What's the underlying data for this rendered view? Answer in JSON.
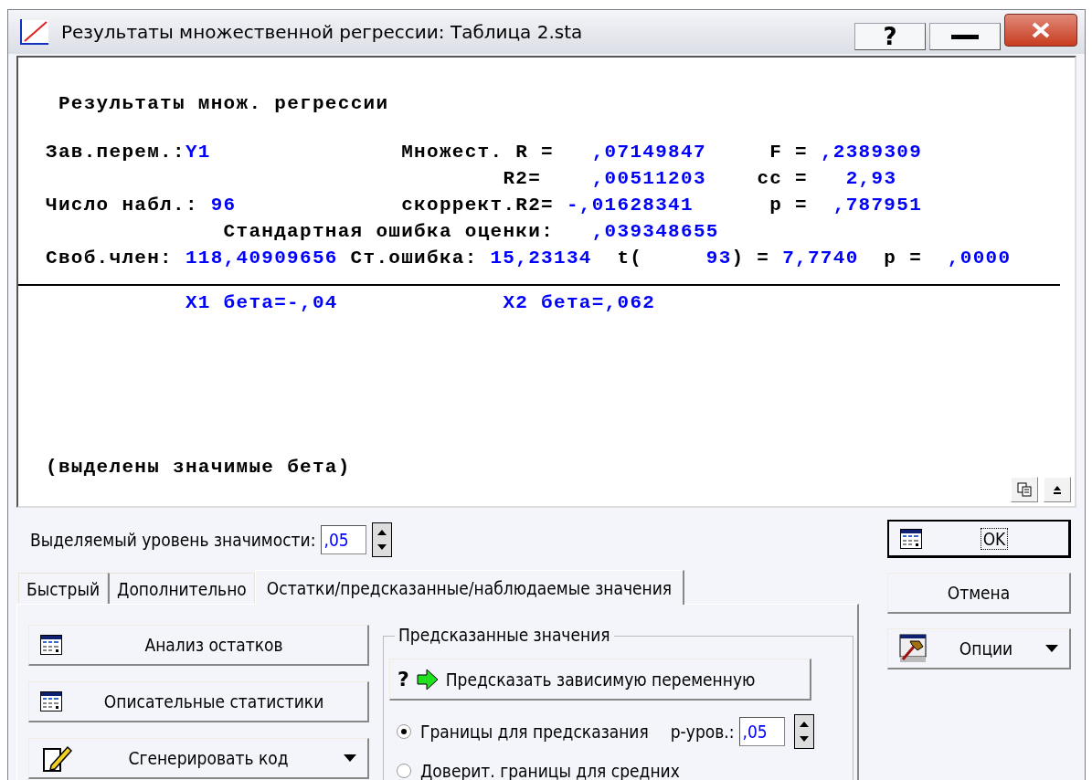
{
  "window": {
    "title": "Результаты множественной регрессии: Таблица 2.sta",
    "help": "?"
  },
  "report": {
    "header": "Результаты множ. регрессии",
    "stats_lines": [
      {
        "segments": [
          {
            "text": "Зав.перем.:",
            "kind": "label"
          },
          {
            "text": "Y1",
            "kind": "value"
          },
          {
            "text": "Множест. R =",
            "kind": "label"
          },
          {
            "text": ",07149847",
            "kind": "value"
          },
          {
            "text": "F =",
            "kind": "label"
          },
          {
            "text": ",2389309",
            "kind": "value"
          }
        ]
      },
      {
        "segments": [
          {
            "text": "R2=",
            "kind": "label"
          },
          {
            "text": ",00511203",
            "kind": "value"
          },
          {
            "text": "cc =",
            "kind": "label"
          },
          {
            "text": "2,93",
            "kind": "value"
          }
        ]
      },
      {
        "segments": [
          {
            "text": "Число набл.:",
            "kind": "label"
          },
          {
            "text": "96",
            "kind": "value"
          },
          {
            "text": "скоррект.R2=",
            "kind": "label"
          },
          {
            "text": "-,01628341",
            "kind": "value"
          },
          {
            "text": "p =",
            "kind": "label"
          },
          {
            "text": ",787951",
            "kind": "value"
          }
        ]
      },
      {
        "segments": [
          {
            "text": "Стандартная ошибка оценки:",
            "kind": "label"
          },
          {
            "text": ",039348655",
            "kind": "value"
          }
        ]
      },
      {
        "segments": [
          {
            "text": "Своб.член:",
            "kind": "label"
          },
          {
            "text": "118,40909656",
            "kind": "value"
          },
          {
            "text": "Ст.ошибка:",
            "kind": "label"
          },
          {
            "text": "15,23134",
            "kind": "value"
          },
          {
            "text": "t(",
            "kind": "label"
          },
          {
            "text": "93",
            "kind": "value"
          },
          {
            "text": ") =",
            "kind": "label"
          },
          {
            "text": "7,7740",
            "kind": "value"
          },
          {
            "text": "p =",
            "kind": "label"
          },
          {
            "text": ",0000",
            "kind": "value"
          }
        ]
      }
    ],
    "betas": [
      {
        "text": "X1 бета=-,04",
        "significant": false
      },
      {
        "text": "X2 бета=,062",
        "significant": false
      }
    ],
    "footnote": "(выделены значимые бета)"
  },
  "significance": {
    "label": "Выделяемый уровень значимости:",
    "value": ",05"
  },
  "tabs": [
    {
      "label": "Быстрый",
      "selected": false
    },
    {
      "label": "Дополнительно",
      "selected": false
    },
    {
      "label": "Остатки/предсказанные/наблюдаемые значения",
      "selected": true
    }
  ],
  "left_buttons": [
    {
      "label": "Анализ остатков",
      "kind": "table",
      "dropdown": false
    },
    {
      "label": "Описательные статистики",
      "kind": "table",
      "dropdown": false
    },
    {
      "label": "Сгенерировать код",
      "kind": "code",
      "dropdown": true
    }
  ],
  "predicted": {
    "title": "Предсказанные значения",
    "button": {
      "glyph": "?",
      "label": "Предсказать зависимую переменную"
    },
    "options": [
      {
        "label": "Границы для предсказания",
        "selected": true,
        "field_label": "р-уров.:",
        "field_value": ",05"
      },
      {
        "label": "Доверит. границы для средних",
        "selected": false
      }
    ]
  },
  "actions": [
    {
      "label": "OK",
      "kind": "table",
      "default": true,
      "dropdown": false
    },
    {
      "label": "Отмена",
      "kind": "plain",
      "default": false,
      "dropdown": false
    },
    {
      "label": "Опции",
      "kind": "tool",
      "default": false,
      "dropdown": true
    }
  ]
}
